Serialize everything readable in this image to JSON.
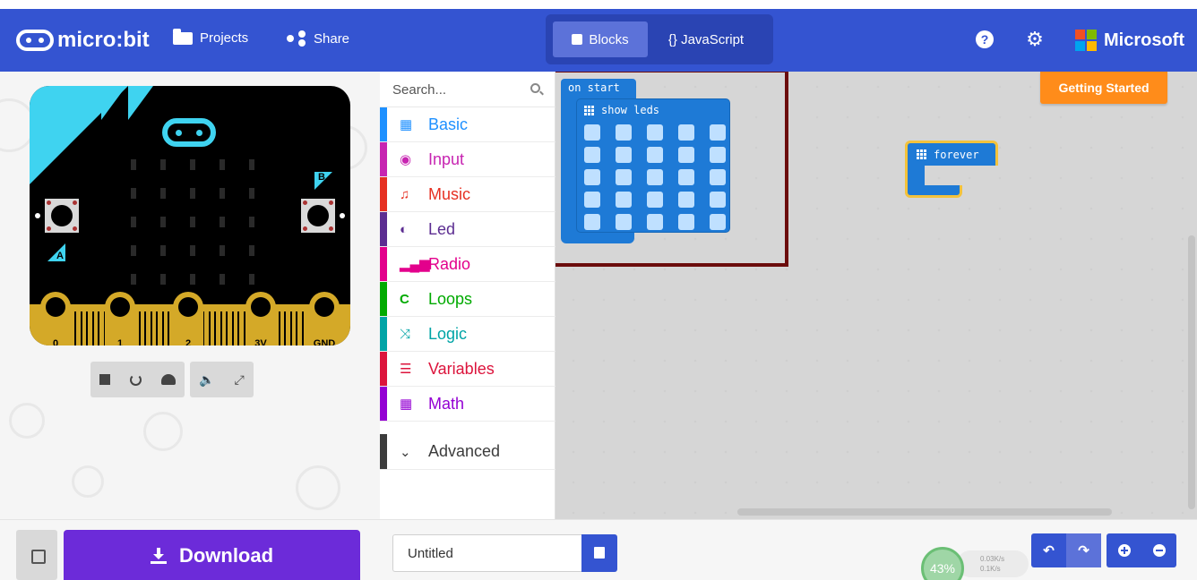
{
  "header": {
    "brand": "micro:bit",
    "projects_label": "Projects",
    "share_label": "Share",
    "tabs": [
      {
        "label": "Blocks",
        "active": true
      },
      {
        "label": "{} JavaScript",
        "active": false
      }
    ],
    "vendor": "Microsoft",
    "icons": [
      "help-icon",
      "gear-icon",
      "microsoft-logo"
    ]
  },
  "simulator": {
    "button_a": "A",
    "button_b": "B",
    "pins": [
      "0",
      "1",
      "2",
      "3V",
      "GND"
    ],
    "controls": [
      "stop-icon",
      "restart-icon",
      "slow-motion-icon",
      "mute-icon",
      "fullscreen-icon"
    ]
  },
  "toolbox": {
    "search_placeholder": "Search...",
    "categories": [
      {
        "label": "Basic",
        "color": "#1e90ff"
      },
      {
        "label": "Input",
        "color": "#c724b1"
      },
      {
        "label": "Music",
        "color": "#e63022"
      },
      {
        "label": "Led",
        "color": "#5c2d91"
      },
      {
        "label": "Radio",
        "color": "#e3008c"
      },
      {
        "label": "Loops",
        "color": "#00aa00"
      },
      {
        "label": "Logic",
        "color": "#00a4a6"
      },
      {
        "label": "Variables",
        "color": "#dc143c"
      },
      {
        "label": "Math",
        "color": "#9400d3"
      },
      {
        "label": "Advanced",
        "color": "#3c3c3c"
      }
    ]
  },
  "workspace": {
    "getting_started": "Getting Started",
    "blocks": {
      "on_start": "on start",
      "show_leds": "show leds",
      "forever": "forever"
    }
  },
  "footer": {
    "download_label": "Download",
    "project_name": "Untitled",
    "perf": {
      "cpu": "43%",
      "up": "0.03K/s",
      "down": "0.1K/s"
    }
  },
  "colors": {
    "header": "#3454d1",
    "download": "#6c2bd9",
    "getting_started": "#ff8c1a",
    "highlight": "#6b0c0c"
  }
}
